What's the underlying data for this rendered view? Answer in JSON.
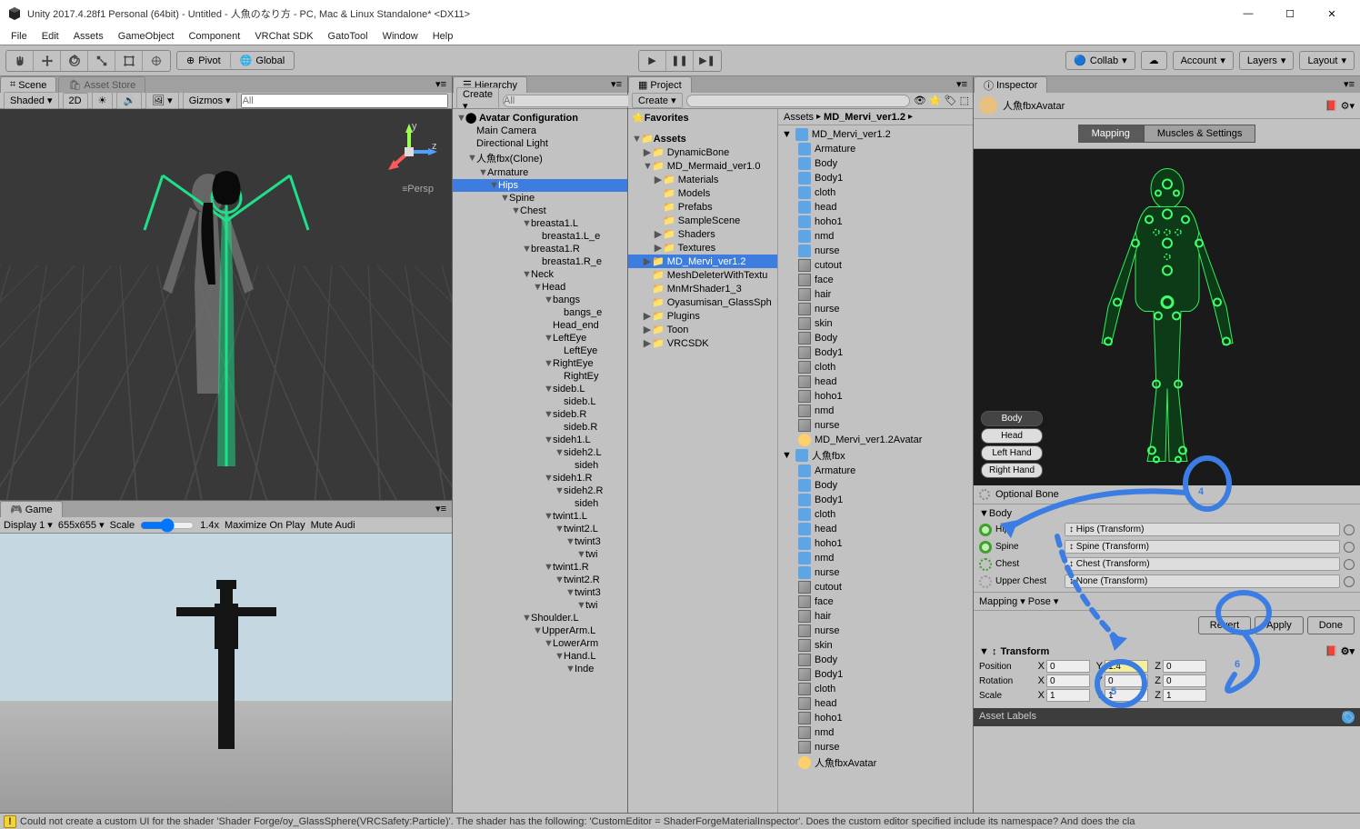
{
  "window": {
    "title": "Unity 2017.4.28f1 Personal (64bit) - Untitled - 人魚のなり方 - PC, Mac & Linux Standalone* <DX11>"
  },
  "menu": [
    "File",
    "Edit",
    "Assets",
    "GameObject",
    "Component",
    "VRChat SDK",
    "GatoTool",
    "Window",
    "Help"
  ],
  "toolbar": {
    "pivot": "Pivot",
    "global": "Global",
    "collab": "Collab",
    "account": "Account",
    "layers": "Layers",
    "layout": "Layout"
  },
  "scene": {
    "tab": "Scene",
    "asset_store": "Asset Store",
    "shaded": "Shaded",
    "twod": "2D",
    "gizmos": "Gizmos",
    "search_ph": "All",
    "persp": "Persp"
  },
  "game": {
    "tab": "Game",
    "display": "Display 1",
    "res": "655x655",
    "scale": "Scale",
    "scale_val": "1.4x",
    "max": "Maximize On Play",
    "mute": "Mute Audi"
  },
  "hierarchy": {
    "tab": "Hierarchy",
    "create": "Create",
    "search_ph": "All",
    "root": "Avatar Configuration",
    "items": [
      {
        "d": 1,
        "t": "Main Camera"
      },
      {
        "d": 1,
        "t": "Directional Light"
      },
      {
        "d": 1,
        "t": "人魚fbx(Clone)",
        "tog": "▼"
      },
      {
        "d": 2,
        "t": "Armature",
        "tog": "▼"
      },
      {
        "d": 3,
        "t": "Hips",
        "tog": "▼",
        "sel": true
      },
      {
        "d": 4,
        "t": "Spine",
        "tog": "▼"
      },
      {
        "d": 5,
        "t": "Chest",
        "tog": "▼"
      },
      {
        "d": 6,
        "t": "breasta1.L",
        "tog": "▼"
      },
      {
        "d": 7,
        "t": "breasta1.L_e"
      },
      {
        "d": 6,
        "t": "breasta1.R",
        "tog": "▼"
      },
      {
        "d": 7,
        "t": "breasta1.R_e"
      },
      {
        "d": 6,
        "t": "Neck",
        "tog": "▼"
      },
      {
        "d": 7,
        "t": "Head",
        "tog": "▼"
      },
      {
        "d": 8,
        "t": "bangs",
        "tog": "▼"
      },
      {
        "d": 9,
        "t": "bangs_e"
      },
      {
        "d": 8,
        "t": "Head_end"
      },
      {
        "d": 8,
        "t": "LeftEye",
        "tog": "▼"
      },
      {
        "d": 9,
        "t": "LeftEye"
      },
      {
        "d": 8,
        "t": "RightEye",
        "tog": "▼"
      },
      {
        "d": 9,
        "t": "RightEy"
      },
      {
        "d": 8,
        "t": "sideb.L",
        "tog": "▼"
      },
      {
        "d": 9,
        "t": "sideb.L"
      },
      {
        "d": 8,
        "t": "sideb.R",
        "tog": "▼"
      },
      {
        "d": 9,
        "t": "sideb.R"
      },
      {
        "d": 8,
        "t": "sideh1.L",
        "tog": "▼"
      },
      {
        "d": 9,
        "t": "sideh2.L",
        "tog": "▼"
      },
      {
        "d": 10,
        "t": "sideh"
      },
      {
        "d": 8,
        "t": "sideh1.R",
        "tog": "▼"
      },
      {
        "d": 9,
        "t": "sideh2.R",
        "tog": "▼"
      },
      {
        "d": 10,
        "t": "sideh"
      },
      {
        "d": 8,
        "t": "twint1.L",
        "tog": "▼"
      },
      {
        "d": 9,
        "t": "twint2.L",
        "tog": "▼"
      },
      {
        "d": 10,
        "t": "twint3",
        "tog": "▼"
      },
      {
        "d": 11,
        "t": "twi",
        "tog": "▼"
      },
      {
        "d": 8,
        "t": "twint1.R",
        "tog": "▼"
      },
      {
        "d": 9,
        "t": "twint2.R",
        "tog": "▼"
      },
      {
        "d": 10,
        "t": "twint3",
        "tog": "▼"
      },
      {
        "d": 11,
        "t": "twi",
        "tog": "▼"
      },
      {
        "d": 6,
        "t": "Shoulder.L",
        "tog": "▼"
      },
      {
        "d": 7,
        "t": "UpperArm.L",
        "tog": "▼"
      },
      {
        "d": 8,
        "t": "LowerArm",
        "tog": "▼"
      },
      {
        "d": 9,
        "t": "Hand.L",
        "tog": "▼"
      },
      {
        "d": 10,
        "t": "Inde",
        "tog": "▼"
      }
    ]
  },
  "project": {
    "tab": "Project",
    "create": "Create",
    "favorites": "Favorites",
    "assets": "Assets",
    "tree": [
      {
        "d": 1,
        "t": "DynamicBone",
        "tog": "▶"
      },
      {
        "d": 1,
        "t": "MD_Mermaid_ver1.0",
        "tog": "▼"
      },
      {
        "d": 2,
        "t": "Materials",
        "tog": "▶"
      },
      {
        "d": 2,
        "t": "Models"
      },
      {
        "d": 2,
        "t": "Prefabs"
      },
      {
        "d": 2,
        "t": "SampleScene"
      },
      {
        "d": 2,
        "t": "Shaders",
        "tog": "▶"
      },
      {
        "d": 2,
        "t": "Textures",
        "tog": "▶"
      },
      {
        "d": 1,
        "t": "MD_Mervi_ver1.2",
        "sel": true,
        "tog": "▶"
      },
      {
        "d": 1,
        "t": "MeshDeleterWithTextu"
      },
      {
        "d": 1,
        "t": "MnMrShader1_3"
      },
      {
        "d": 1,
        "t": "Oyasumisan_GlassSph"
      },
      {
        "d": 1,
        "t": "Plugins",
        "tog": "▶"
      },
      {
        "d": 1,
        "t": "Toon",
        "tog": "▶"
      },
      {
        "d": 1,
        "t": "VRCSDK",
        "tog": "▶"
      }
    ],
    "crumb": [
      "Assets",
      "MD_Mervi_ver1.2"
    ],
    "items": [
      {
        "t": "MD_Mervi_ver1.2",
        "ico": "prefab",
        "tog": "▼"
      },
      {
        "t": "Armature",
        "ico": "prefab",
        "d": 1
      },
      {
        "t": "Body",
        "ico": "prefab",
        "d": 1
      },
      {
        "t": "Body1",
        "ico": "prefab",
        "d": 1
      },
      {
        "t": "cloth",
        "ico": "prefab",
        "d": 1
      },
      {
        "t": "head",
        "ico": "prefab",
        "d": 1
      },
      {
        "t": "hoho1",
        "ico": "prefab",
        "d": 1
      },
      {
        "t": "nmd",
        "ico": "prefab",
        "d": 1
      },
      {
        "t": "nurse",
        "ico": "prefab",
        "d": 1
      },
      {
        "t": "cutout",
        "ico": "mesh",
        "d": 1
      },
      {
        "t": "face",
        "ico": "mesh",
        "d": 1
      },
      {
        "t": "hair",
        "ico": "mesh",
        "d": 1
      },
      {
        "t": "nurse",
        "ico": "mesh",
        "d": 1
      },
      {
        "t": "skin",
        "ico": "mesh",
        "d": 1
      },
      {
        "t": "Body",
        "ico": "mesh",
        "d": 1
      },
      {
        "t": "Body1",
        "ico": "mesh",
        "d": 1
      },
      {
        "t": "cloth",
        "ico": "mesh",
        "d": 1
      },
      {
        "t": "head",
        "ico": "mesh",
        "d": 1
      },
      {
        "t": "hoho1",
        "ico": "mesh",
        "d": 1
      },
      {
        "t": "nmd",
        "ico": "mesh",
        "d": 1
      },
      {
        "t": "nurse",
        "ico": "mesh",
        "d": 1
      },
      {
        "t": "MD_Mervi_ver1.2Avatar",
        "ico": "avatar",
        "d": 1
      },
      {
        "t": "人魚fbx",
        "ico": "prefab",
        "tog": "▼"
      },
      {
        "t": "Armature",
        "ico": "prefab",
        "d": 1
      },
      {
        "t": "Body",
        "ico": "prefab",
        "d": 1
      },
      {
        "t": "Body1",
        "ico": "prefab",
        "d": 1
      },
      {
        "t": "cloth",
        "ico": "prefab",
        "d": 1
      },
      {
        "t": "head",
        "ico": "prefab",
        "d": 1
      },
      {
        "t": "hoho1",
        "ico": "prefab",
        "d": 1
      },
      {
        "t": "nmd",
        "ico": "prefab",
        "d": 1
      },
      {
        "t": "nurse",
        "ico": "prefab",
        "d": 1
      },
      {
        "t": "cutout",
        "ico": "mesh",
        "d": 1
      },
      {
        "t": "face",
        "ico": "mesh",
        "d": 1
      },
      {
        "t": "hair",
        "ico": "mesh",
        "d": 1
      },
      {
        "t": "nurse",
        "ico": "mesh",
        "d": 1
      },
      {
        "t": "skin",
        "ico": "mesh",
        "d": 1
      },
      {
        "t": "Body",
        "ico": "mesh",
        "d": 1
      },
      {
        "t": "Body1",
        "ico": "mesh",
        "d": 1
      },
      {
        "t": "cloth",
        "ico": "mesh",
        "d": 1
      },
      {
        "t": "head",
        "ico": "mesh",
        "d": 1
      },
      {
        "t": "hoho1",
        "ico": "mesh",
        "d": 1
      },
      {
        "t": "nmd",
        "ico": "mesh",
        "d": 1
      },
      {
        "t": "nurse",
        "ico": "mesh",
        "d": 1
      },
      {
        "t": "人魚fbxAvatar",
        "ico": "avatar",
        "d": 1
      }
    ]
  },
  "inspector": {
    "tab": "Inspector",
    "name": "人魚fbxAvatar",
    "mapping": "Mapping",
    "muscles": "Muscles & Settings",
    "body": "Body",
    "head": "Head",
    "lhand": "Left Hand",
    "rhand": "Right Hand",
    "optional": "Optional Bone",
    "section": "Body",
    "bones": [
      {
        "name": "Hips",
        "val": "Hips (Transform)",
        "dot": "solid"
      },
      {
        "name": "Spine",
        "val": "Spine (Transform)",
        "dot": "solid"
      },
      {
        "name": "Chest",
        "val": "Chest (Transform)",
        "dot": "dotted"
      },
      {
        "name": "Upper Chest",
        "val": "None (Transform)",
        "dot": "empty"
      }
    ],
    "mapping_btn": "Mapping",
    "pose_btn": "Pose",
    "revert": "Revert",
    "apply": "Apply",
    "done": "Done",
    "transform": "Transform",
    "position": "Position",
    "rotation": "Rotation",
    "scale": "Scale",
    "pos": {
      "x": "0",
      "y": "1.4",
      "z": "0"
    },
    "rot": {
      "x": "0",
      "y": "0",
      "z": "0"
    },
    "scl": {
      "x": "1",
      "y": "1",
      "z": "1"
    },
    "labels": "Asset Labels"
  },
  "status": {
    "msg": "Could not create a custom UI for the shader 'Shader Forge/oy_GlassSphere(VRCSafety:Particle)'. The shader has the following: 'CustomEditor = ShaderForgeMaterialInspector'. Does the custom editor specified include its namespace? And does the cla"
  }
}
